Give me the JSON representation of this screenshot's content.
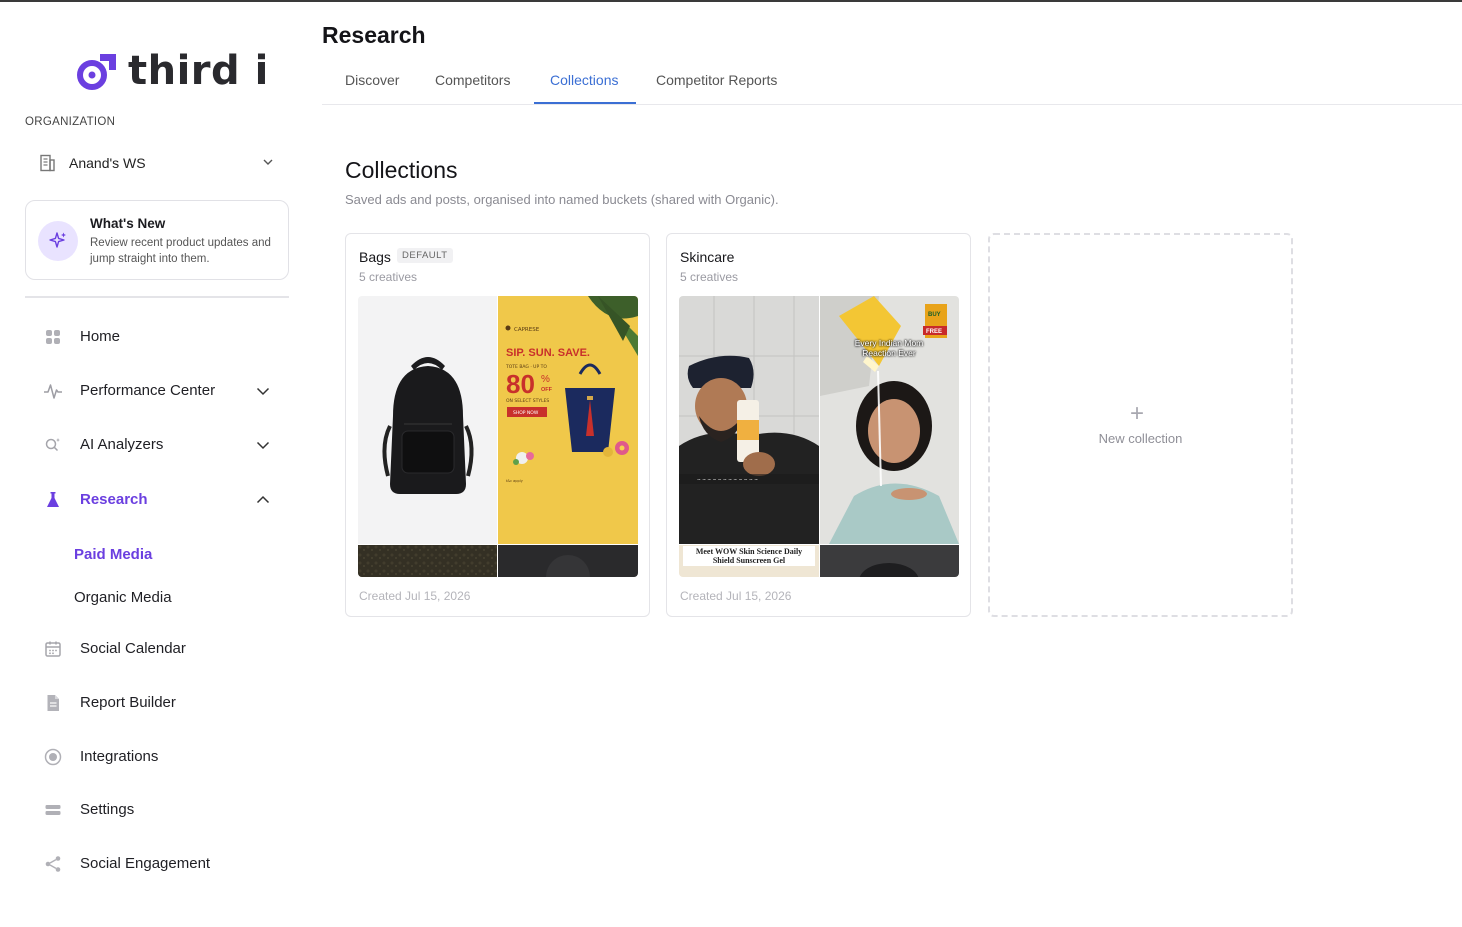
{
  "brand": {
    "name": "third i",
    "accent": "#6b3fe0"
  },
  "sidebar": {
    "org_label": "ORGANIZATION",
    "org_name": "Anand's WS",
    "whats_new": {
      "title": "What's New",
      "description": "Review recent product updates and jump straight into them."
    },
    "items": [
      {
        "label": "Home",
        "icon": "grid-icon"
      },
      {
        "label": "Performance Center",
        "icon": "pulse-icon"
      },
      {
        "label": "AI Analyzers",
        "icon": "search-sparkle-icon"
      },
      {
        "label": "Research",
        "icon": "flask-icon"
      },
      {
        "label": "Social Calendar",
        "icon": "calendar-icon"
      },
      {
        "label": "Report Builder",
        "icon": "document-icon"
      },
      {
        "label": "Integrations",
        "icon": "target-icon"
      },
      {
        "label": "Settings",
        "icon": "settings-icon"
      },
      {
        "label": "Social Engagement",
        "icon": "share-icon"
      }
    ],
    "research_sub": [
      {
        "label": "Paid Media"
      },
      {
        "label": "Organic Media"
      }
    ]
  },
  "header": {
    "title": "Research",
    "tabs": [
      {
        "label": "Discover"
      },
      {
        "label": "Competitors"
      },
      {
        "label": "Collections"
      },
      {
        "label": "Competitor Reports"
      }
    ],
    "active_tab": "Collections"
  },
  "main": {
    "title": "Collections",
    "subtitle": "Saved ads and posts, organised into named buckets (shared with Organic).",
    "collections": [
      {
        "name": "Bags",
        "badge": "DEFAULT",
        "count": "5 creatives",
        "created": "Created Jul 15, 2026",
        "ad_text": {
          "brand": "CAPRESE",
          "headline": "SIP. SUN. SAVE.",
          "small": "TOTE BAG · UP TO",
          "big": "80",
          "off": "OFF",
          "styles": "ON SELECT STYLES",
          "cta": "SHOP NOW"
        }
      },
      {
        "name": "Skincare",
        "badge": "",
        "count": "5 creatives",
        "created": "Created Jul 15, 2026",
        "ad_text": {
          "caption_top": "Every Indian Mom Reaction Ever",
          "buy": "BUY",
          "free": "FREE",
          "caption_bottom": "Meet WOW Skin Science Daily Shield Sunscreen Gel"
        }
      }
    ],
    "new_collection_label": "New collection"
  }
}
